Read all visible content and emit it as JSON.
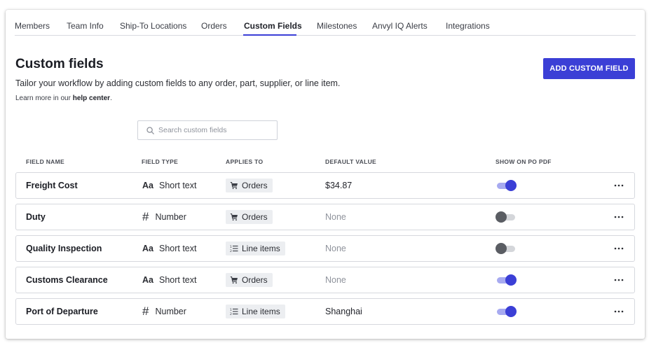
{
  "tabs": [
    {
      "label": "Members"
    },
    {
      "label": "Team Info"
    },
    {
      "label": "Ship-To Locations"
    },
    {
      "label": "Orders"
    },
    {
      "label": "Custom Fields",
      "active": true
    },
    {
      "label": "Milestones"
    },
    {
      "label": "Anvyl IQ Alerts"
    },
    {
      "label": "Integrations"
    }
  ],
  "header": {
    "title": "Custom fields",
    "subtitle": "Tailor your workflow by adding custom fields to any order, part, supplier, or line item.",
    "learn_more_prefix": "Learn more in our",
    "learn_more_link": "help center",
    "learn_more_suffix": ".",
    "add_button": "ADD CUSTOM FIELD"
  },
  "search": {
    "placeholder": "Search custom fields",
    "value": ""
  },
  "columns": {
    "field_name": "FIELD NAME",
    "field_type": "FIELD TYPE",
    "applies_to": "APPLIES TO",
    "default_value": "DEFAULT VALUE",
    "show_on_po_pdf": "SHOW ON PO PDF"
  },
  "type_icons": {
    "short_text": "Aa",
    "number": "#"
  },
  "rows": [
    {
      "name": "Freight Cost",
      "type_icon": "Aa",
      "type": "Short text",
      "applies_icon": "cart-icon",
      "applies": "Orders",
      "default": "$34.87",
      "show_on_pdf": true
    },
    {
      "name": "Duty",
      "type_icon": "#",
      "type": "Number",
      "applies_icon": "cart-icon",
      "applies": "Orders",
      "default": "None",
      "show_on_pdf": false
    },
    {
      "name": "Quality Inspection",
      "type_icon": "Aa",
      "type": "Short text",
      "applies_icon": "list-icon",
      "applies": "Line items",
      "default": "None",
      "show_on_pdf": false
    },
    {
      "name": "Customs Clearance",
      "type_icon": "Aa",
      "type": "Short text",
      "applies_icon": "cart-icon",
      "applies": "Orders",
      "default": "None",
      "show_on_pdf": true
    },
    {
      "name": "Port of Departure",
      "type_icon": "#",
      "type": "Number",
      "applies_icon": "list-icon",
      "applies": "Line items",
      "default": "Shanghai",
      "show_on_pdf": true
    }
  ],
  "colors": {
    "accent": "#3b3fd6",
    "toggle_on_track": "#a7aaf0",
    "toggle_off_knob": "#5a5d63",
    "muted_text": "#8f939c"
  }
}
